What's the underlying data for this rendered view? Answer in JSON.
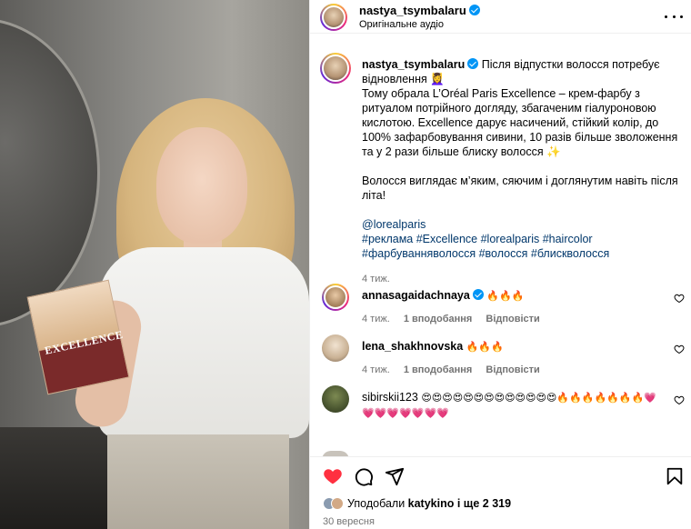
{
  "post": {
    "author": "nastya_tsymbalaru",
    "audio": "Оригінальне аудіо",
    "video_box_text": "EXCELLENCE"
  },
  "caption": {
    "author": "nastya_tsymbalaru",
    "line1": "Після відпустки волосся потребує відновлення 💆‍♀️",
    "line2": "Тому обрала L’Oréal Paris Excellence – крем-фарбу з ритуалом потрійного догляду, збагаченим гіалуроновою кислотою. Excellence дарує насичений, стійкий колір, до 100% зафарбовування сивини, 10 разів більше зволоження та у 2 рази більше блиску волосся ✨",
    "line3": "Волосся виглядає м’яким, сяючим і доглянутим навіть після літа!",
    "mention": "@lorealparis",
    "tags1": "#реклама #Excellence #lorealparis #haircolor",
    "tags2": "#фарбуванняволосся #волосся #блискволосся",
    "time": "4 тиж."
  },
  "comments": [
    {
      "user": "annasagaidachnaya",
      "verified": true,
      "text": "🔥🔥🔥",
      "time": "4 тиж.",
      "likes": "1 вподобання",
      "reply": "Відповісти"
    },
    {
      "user": "lena_shakhnovska",
      "verified": false,
      "text": "🔥🔥🔥",
      "time": "4 тиж.",
      "likes": "1 вподобання",
      "reply": "Відповісти"
    },
    {
      "user": "sibirskii123",
      "verified": false,
      "text": "😍😍😍😍😍😍😍😍😍😍😍😍😍🔥🔥🔥🔥🔥🔥🔥💗💗💗💗💗💗💗💗"
    }
  ],
  "footer": {
    "liked_prefix": "Уподобали ",
    "liked_user": "katykino",
    "liked_suffix": " і ще 2 319",
    "date": "30 вересня"
  },
  "colors": {
    "accent_blue": "#0095f6",
    "like_red": "#ff3040",
    "muted": "#737373",
    "link": "#00376b"
  }
}
